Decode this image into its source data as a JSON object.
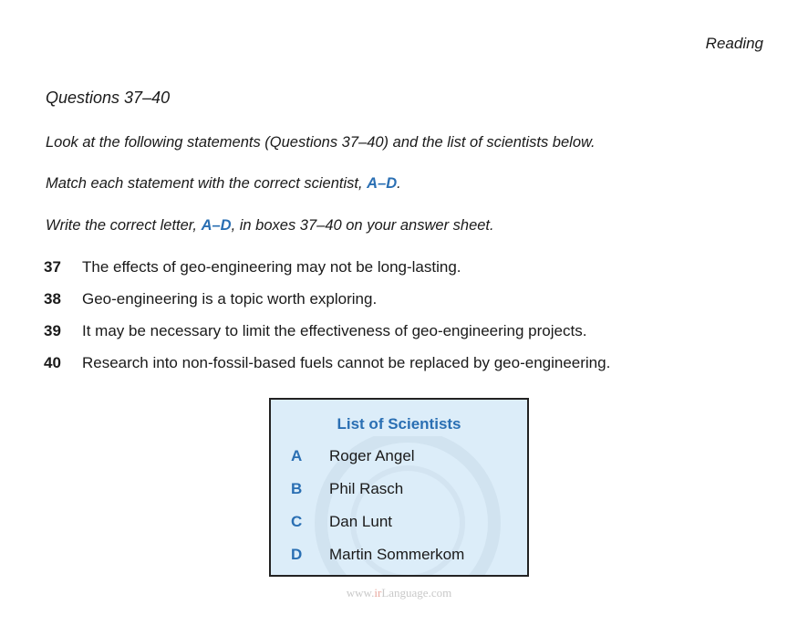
{
  "section_label": "Reading",
  "questions_title": "Questions 37–40",
  "instructions": {
    "line1": "Look at the following statements (Questions 37–40) and the list of scientists below.",
    "line2_pre": "Match each statement with the correct scientist, ",
    "line2_hl": "A–D",
    "line2_post": ".",
    "line3_pre": "Write the correct letter, ",
    "line3_hl": "A–D",
    "line3_post": ", in boxes 37–40 on your answer sheet."
  },
  "questions": [
    {
      "number": "37",
      "text": "The effects of geo-engineering may not be long-lasting."
    },
    {
      "number": "38",
      "text": "Geo-engineering is a topic worth exploring."
    },
    {
      "number": "39",
      "text": "It may be necessary to limit the effectiveness of geo-engineering projects."
    },
    {
      "number": "40",
      "text": "Research into non-fossil-based fuels cannot be replaced by geo-engineering."
    }
  ],
  "scientist_box": {
    "title": "List of Scientists",
    "items": [
      {
        "letter": "A",
        "name": "Roger Angel"
      },
      {
        "letter": "B",
        "name": "Phil Rasch"
      },
      {
        "letter": "C",
        "name": "Dan Lunt"
      },
      {
        "letter": "D",
        "name": "Martin Sommerkom"
      }
    ]
  },
  "watermark": {
    "prefix": "www.",
    "accent": "ir",
    "main": "Language",
    "suffix": ".com"
  },
  "colors": {
    "accent_blue": "#2a6fb3",
    "box_background": "#dcedf9"
  }
}
